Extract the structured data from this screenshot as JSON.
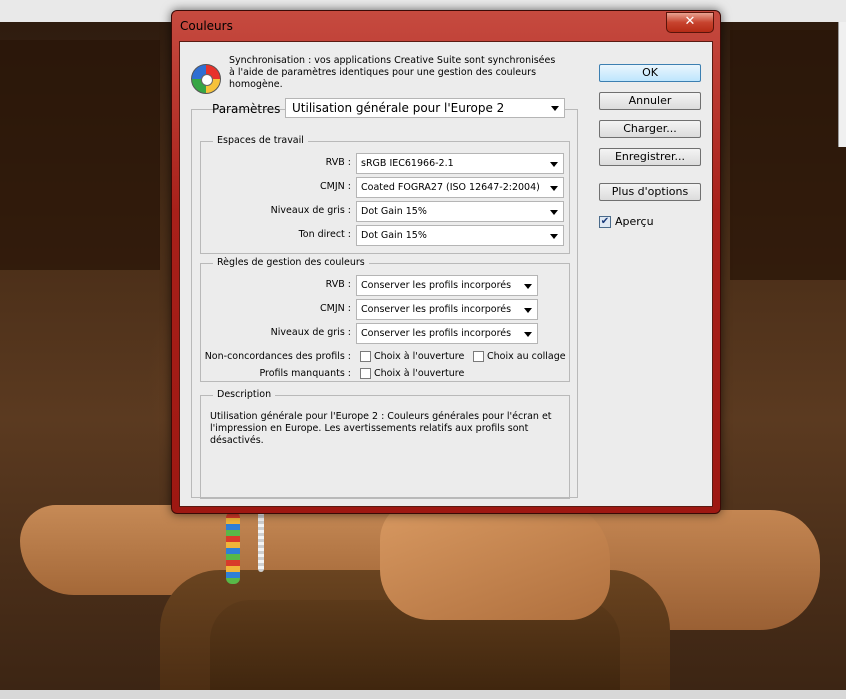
{
  "dialog": {
    "title": "Couleurs",
    "close_symbol": "✕",
    "sync_text": "Synchronisation : vos applications Creative Suite sont synchronisées à l'aide de paramètres identiques pour une gestion des couleurs homogène.",
    "params_label": "Paramètres :",
    "params_value": "Utilisation générale pour l'Europe 2"
  },
  "workspaces": {
    "title": "Espaces de travail",
    "rows": [
      {
        "label": "RVB :",
        "value": "sRGB IEC61966-2.1"
      },
      {
        "label": "CMJN :",
        "value": "Coated FOGRA27 (ISO 12647-2:2004)"
      },
      {
        "label": "Niveaux de gris :",
        "value": "Dot Gain 15%"
      },
      {
        "label": "Ton direct :",
        "value": "Dot Gain 15%"
      }
    ]
  },
  "policies": {
    "title": "Règles de gestion des couleurs",
    "rows": [
      {
        "label": "RVB :",
        "value": "Conserver les profils incorporés"
      },
      {
        "label": "CMJN :",
        "value": "Conserver les profils incorporés"
      },
      {
        "label": "Niveaux de gris :",
        "value": "Conserver les profils incorporés"
      }
    ],
    "mismatch_label": "Non-concordances des profils :",
    "mismatch_open": "Choix à l'ouverture",
    "mismatch_paste": "Choix au collage",
    "missing_label": "Profils manquants :",
    "missing_open": "Choix à l'ouverture"
  },
  "description": {
    "title": "Description",
    "text": "Utilisation générale pour l'Europe 2 :  Couleurs générales pour l'écran et l'impression en Europe. Les avertissements relatifs aux profils sont désactivés."
  },
  "buttons": {
    "ok": "OK",
    "cancel": "Annuler",
    "load": "Charger...",
    "save": "Enregistrer...",
    "more": "Plus d'options"
  },
  "preview": {
    "label": "Aperçu",
    "checked": true,
    "check_symbol": "✔"
  }
}
